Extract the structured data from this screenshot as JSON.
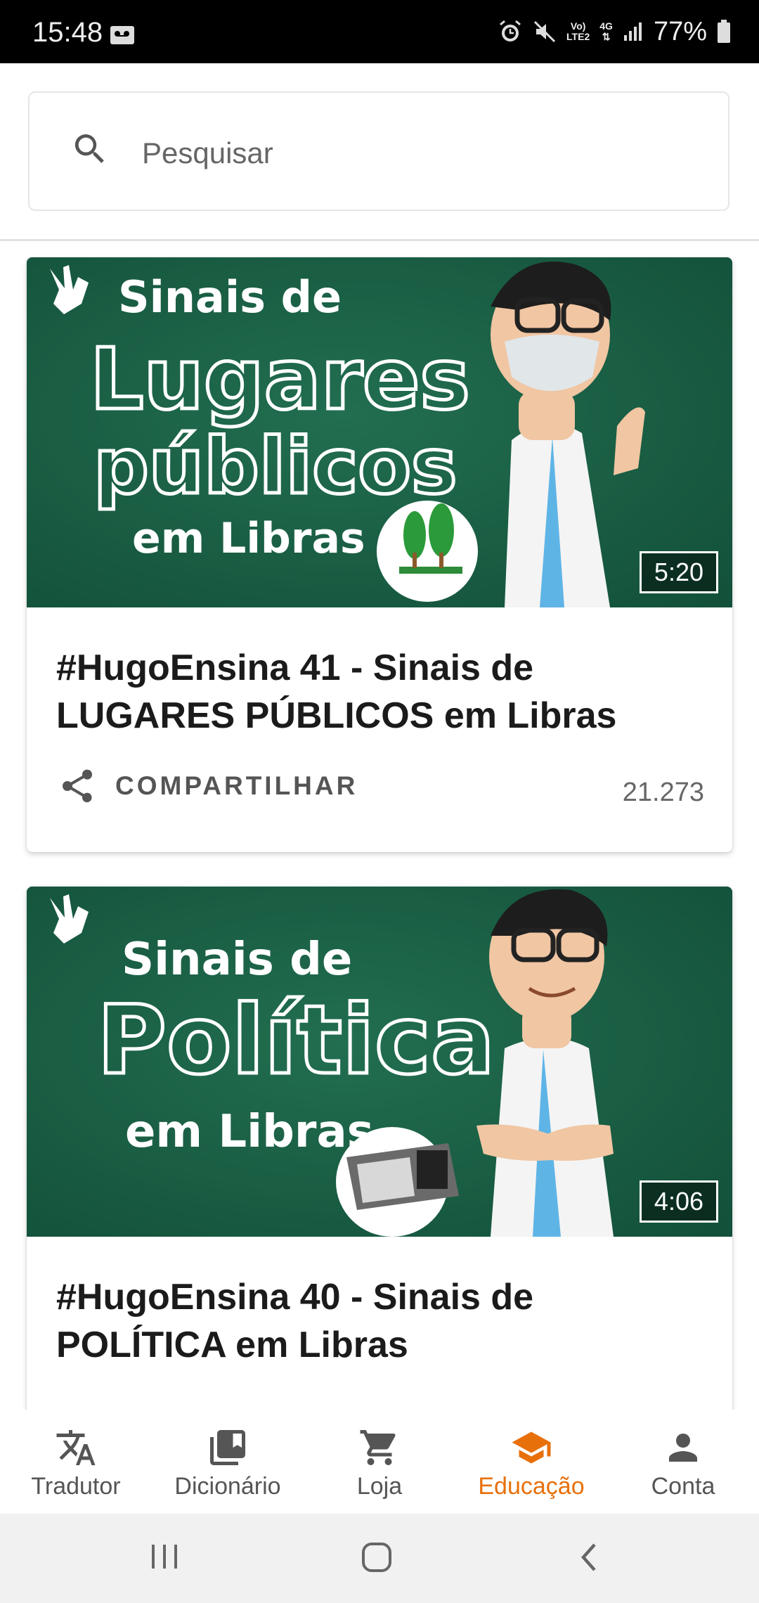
{
  "status_bar": {
    "time": "15:48",
    "network_top": "Vo)",
    "network_bottom": "LTE2",
    "data_top": "4G",
    "battery": "77%"
  },
  "search": {
    "placeholder": "Pesquisar"
  },
  "videos": [
    {
      "title": "#HugoEnsina 41 - Sinais de LUGARES PÚBLICOS em Libras",
      "duration": "5:20",
      "share_label": "COMPARTILHAR",
      "views": "21.273",
      "thumb": {
        "line1": "Sinais de",
        "line2": "Lugares",
        "line3": "públicos",
        "line4": "em Libras"
      }
    },
    {
      "title": "#HugoEnsina 40 - Sinais de POLÍTICA em Libras",
      "duration": "4:06",
      "thumb": {
        "line1": "Sinais de",
        "line2": "Política",
        "line3": "em Libras"
      }
    }
  ],
  "bottom_nav": [
    {
      "label": "Tradutor",
      "icon": "translate-icon"
    },
    {
      "label": "Dicionário",
      "icon": "library-icon"
    },
    {
      "label": "Loja",
      "icon": "cart-icon"
    },
    {
      "label": "Educação",
      "icon": "school-icon",
      "active": true
    },
    {
      "label": "Conta",
      "icon": "person-icon"
    }
  ],
  "colors": {
    "accent": "#e8700b",
    "chalkboard": "#1a5e44"
  }
}
